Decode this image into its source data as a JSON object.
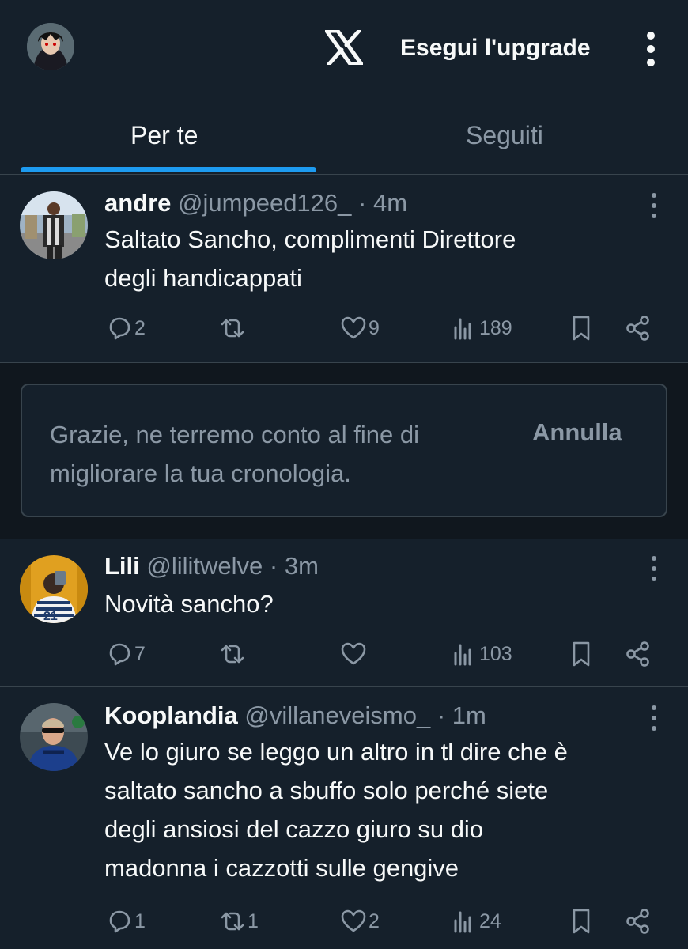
{
  "header": {
    "upgrade_label": "Esegui l'upgrade"
  },
  "tabs": [
    {
      "label": "Per te",
      "active": true
    },
    {
      "label": "Seguiti",
      "active": false
    }
  ],
  "tweets": [
    {
      "name": "andre",
      "handle": "@jumpeed126_",
      "separator": "·",
      "time": "4m",
      "lines": [
        "Saltato Sancho, complimenti Direttore",
        "degli handicappati"
      ],
      "replies": "2",
      "reposts": "",
      "likes": "9",
      "views": "189"
    },
    {
      "name": "Lili",
      "handle": "@lilitwelve",
      "separator": "·",
      "time": "3m",
      "lines": [
        "Novità sancho?"
      ],
      "replies": "7",
      "reposts": "",
      "likes": "",
      "views": "103"
    },
    {
      "name": "Kooplandia",
      "handle": "@villaneveismo_",
      "separator": "·",
      "time": "1m",
      "lines": [
        "Ve lo giuro se leggo un altro in tl dire che è",
        "saltato sancho a sbuffo solo perché siete",
        "degli ansiosi del cazzo giuro su dio",
        "madonna i cazzotti sulle gengive"
      ],
      "replies": "1",
      "reposts": "1",
      "likes": "2",
      "views": "24"
    }
  ],
  "notice": {
    "lines": [
      "Grazie, ne terremo conto al fine di",
      "migliorare la tua cronologia."
    ],
    "undo_label": "Annulla"
  },
  "colors": {
    "background": "#15202b",
    "accent": "#1d9bf0",
    "muted": "#8b98a5",
    "divider": "#38444d"
  },
  "icons": [
    "x-logo-icon",
    "kebab-menu-icon",
    "reply-icon",
    "repost-icon",
    "like-icon",
    "views-icon",
    "bookmark-icon",
    "share-icon"
  ]
}
